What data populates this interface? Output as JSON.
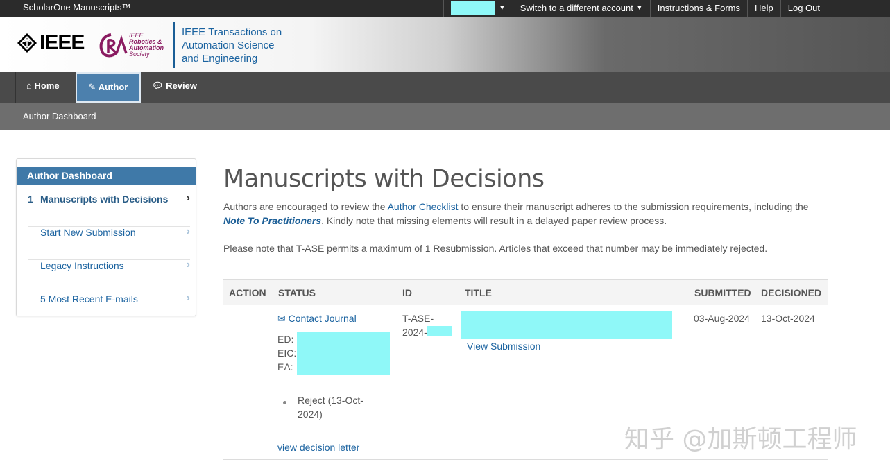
{
  "topbar": {
    "brand": "ScholarOne Manuscripts™",
    "switch_account": "Switch to a different account",
    "instructions": "Instructions & Forms",
    "help": "Help",
    "logout": "Log Out"
  },
  "header": {
    "ieee": "IEEE",
    "ras_line1": "IEEE",
    "ras_line2": "Robotics &",
    "ras_line3": "Automation",
    "ras_line4": "Society",
    "journal_line1": "IEEE Transactions on",
    "journal_line2": "Automation Science",
    "journal_line3": "and Engineering"
  },
  "tabs": {
    "home": "Home",
    "author": "Author",
    "review": "Review"
  },
  "breadcrumb": "Author Dashboard",
  "sidebar": {
    "heading": "Author Dashboard",
    "items": [
      {
        "num": "1",
        "label": "Manuscripts with Decisions"
      },
      {
        "num": "",
        "label": "Start New Submission"
      },
      {
        "num": "",
        "label": "Legacy Instructions"
      },
      {
        "num": "",
        "label": "5 Most Recent E-mails"
      }
    ]
  },
  "main": {
    "title": "Manuscripts with Decisions",
    "para1_a": "Authors are encouraged to review the ",
    "para1_link": "Author Checklist",
    "para1_b": " to ensure their manuscript adheres to the submission requirements, including the",
    "para1_bold": "Note To Practitioners",
    "para1_c": ". Kindly note that missing elements will result in a delayed paper review process.",
    "para2": "Please note that T-ASE permits a maximum of 1 Resubmission. Articles that exceed that number may be immediately rejected."
  },
  "table": {
    "headers": [
      "ACTION",
      "STATUS",
      "ID",
      "TITLE",
      "SUBMITTED",
      "DECISIONED"
    ],
    "row": {
      "contact": "Contact Journal",
      "ed": "ED:",
      "eic": "EIC:",
      "ea": "EA:",
      "decision_line1": "Reject (13-Oct-",
      "decision_line2": "2024)",
      "decision_letter": "view decision letter",
      "id_line1": "T-ASE-",
      "id_line2": "2024-",
      "view_submission": "View Submission",
      "submitted": "03-Aug-2024",
      "decisioned": "13-Oct-2024"
    }
  },
  "watermark": "知乎 @加斯顿工程师"
}
